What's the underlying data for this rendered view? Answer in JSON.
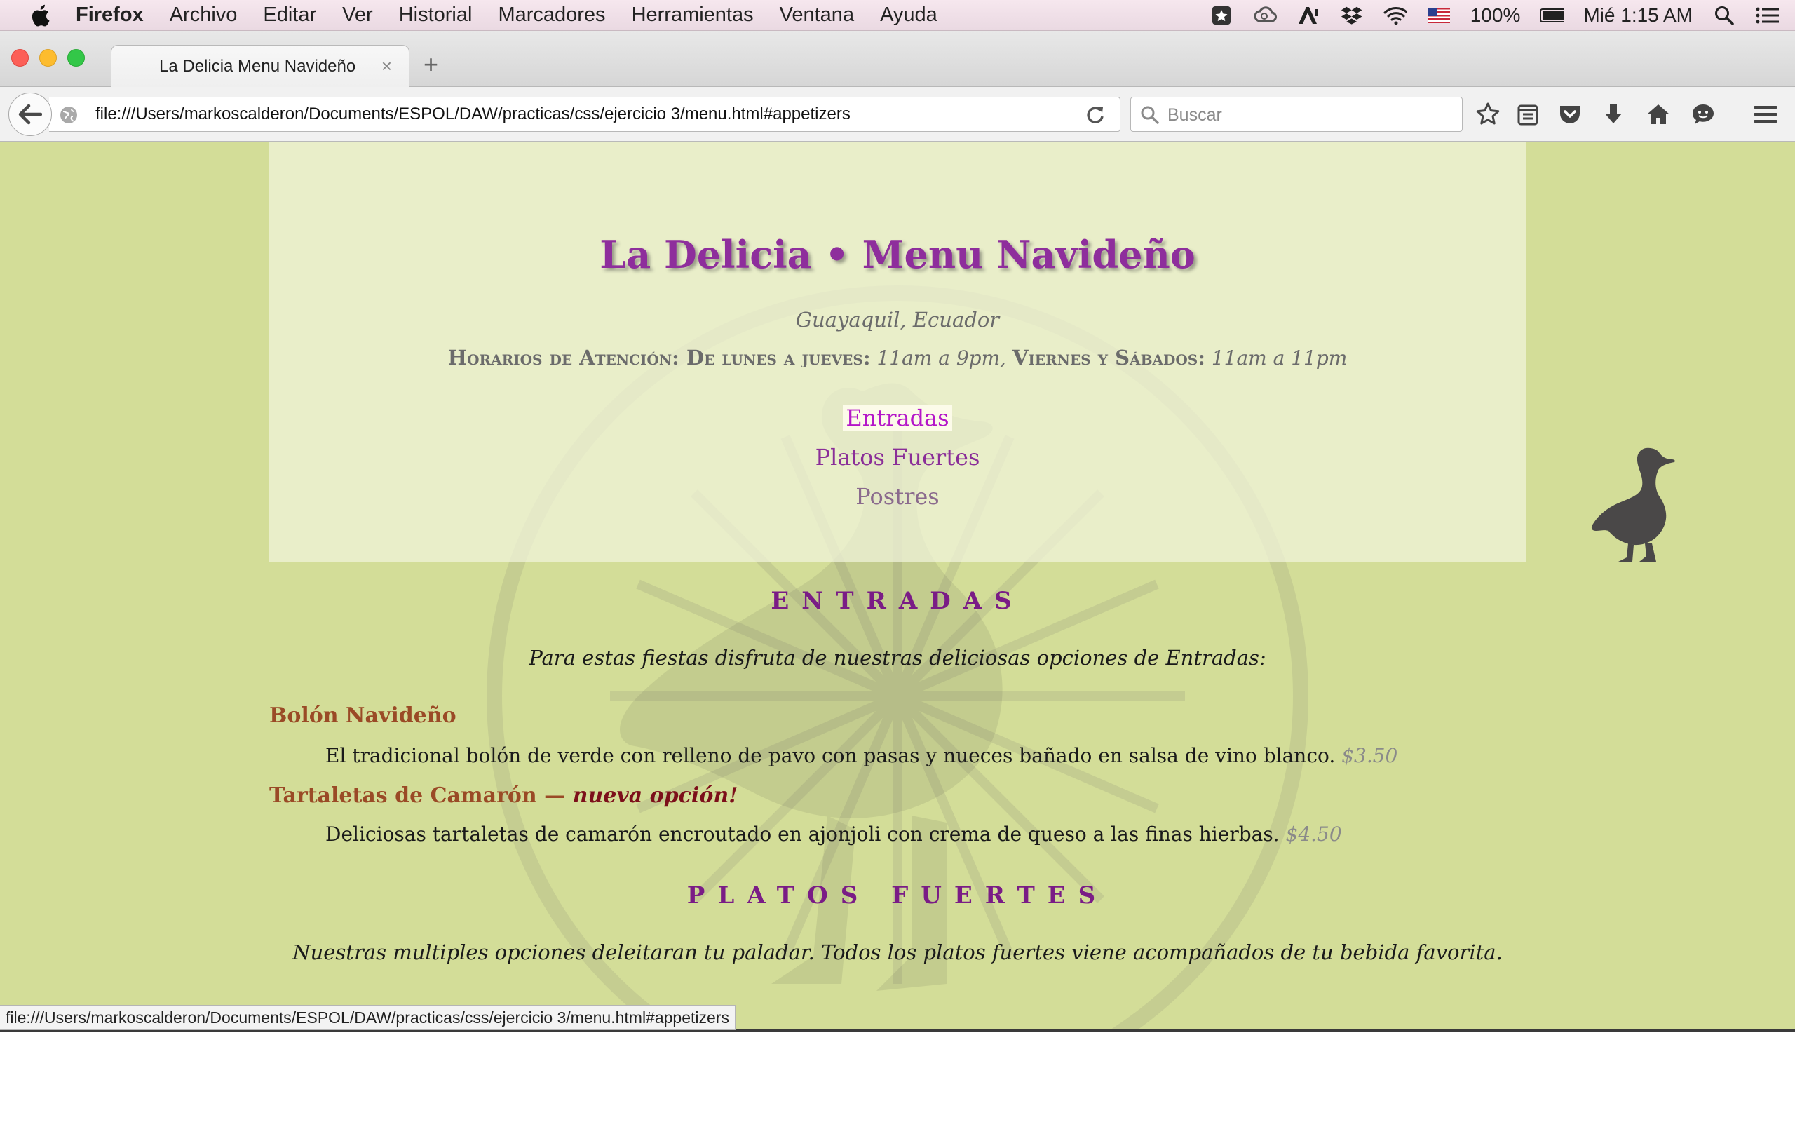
{
  "menubar": {
    "app_name": "Firefox",
    "items": [
      "Archivo",
      "Editar",
      "Ver",
      "Historial",
      "Marcadores",
      "Herramientas",
      "Ventana",
      "Ayuda"
    ],
    "battery": "100%",
    "clock": "Mié 1:15 AM"
  },
  "tab": {
    "title": "La Delicia Menu Navideño",
    "close": "×",
    "new": "+"
  },
  "navbar": {
    "url": "file:///Users/markoscalderon/Documents/ESPOL/DAW/practicas/css/ejercicio 3/menu.html#appetizers",
    "search_placeholder": "Buscar"
  },
  "page": {
    "title": "La Delicia • Menu Navideño",
    "location": "Guayaquil, Ecuador",
    "hours": {
      "label1": "Horarios de Atención: De lunes a jueves:",
      "time1": "11am a 9pm,",
      "label2": "Viernes y Sábados:",
      "time2": "11am a 11pm"
    },
    "nav": [
      "Entradas",
      "Platos Fuertes",
      "Postres"
    ],
    "sections": [
      {
        "heading": "ENTRADAS",
        "intro": "Para estas fiestas disfruta de nuestras deliciosas opciones de Entradas:",
        "items": [
          {
            "name": "Bolón Navideño",
            "badge": "",
            "desc": "El tradicional bolón de verde con relleno de pavo con pasas y nueces bañado en salsa de vino blanco.",
            "price": "$3.50"
          },
          {
            "name": "Tartaletas de Camarón —",
            "badge": "nueva opción!",
            "desc": "Deliciosas tartaletas de camarón encroutado en ajonjoli con crema de queso a las finas hierbas.",
            "price": "$4.50"
          }
        ]
      },
      {
        "heading": "PLATOS FUERTES",
        "intro": "Nuestras multiples opciones deleitaran tu paladar. Todos los platos fuertes viene acompañados de tu bebida favorita."
      }
    ]
  },
  "statusbar": {
    "text": "file:///Users/markoscalderon/Documents/ESPOL/DAW/practicas/css/ejercicio 3/menu.html#appetizers"
  }
}
